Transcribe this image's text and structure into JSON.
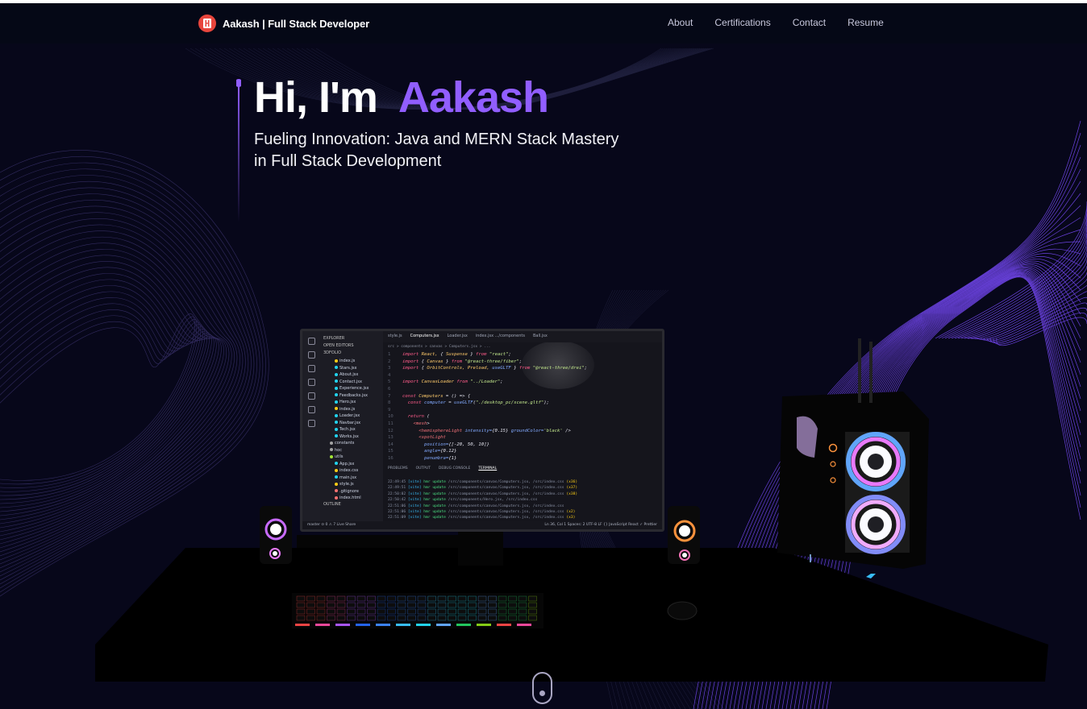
{
  "navbar": {
    "brand": "Aakash | Full Stack Developer",
    "links": [
      "About",
      "Certifications",
      "Contact",
      "Resume"
    ]
  },
  "hero": {
    "greeting": "Hi, I'm",
    "name": "Aakash",
    "subtitle": "Fueling Innovation: Java and MERN Stack Mastery in Full Stack Development"
  },
  "colors": {
    "background": "#07071a",
    "accent": "#915eff",
    "logo": "#e8453c"
  },
  "icons": {
    "logo": "logo-icon",
    "scroll": "scroll-down-icon"
  },
  "editor": {
    "explorer_title": "EXPLORER",
    "open_editors": "OPEN EDITORS",
    "project": "3DFOLIO",
    "files": [
      "index.js",
      "Stars.jsx",
      "About.jsx",
      "Contact.jsx",
      "Experience.jsx",
      "Feedbacks.jsx",
      "Hero.jsx",
      "index.js",
      "Loader.jsx",
      "Navbar.jsx",
      "Tech.jsx",
      "Works.jsx",
      "constants",
      "hoc",
      "utils",
      "App.jsx",
      "index.css",
      "main.jsx",
      "style.js",
      ".gitignore",
      "index.html"
    ],
    "outline": "OUTLINE",
    "tabs": [
      "style.js",
      "Computers.jsx",
      "Loader.jsx",
      "index.jsx .../components",
      "Ball.jsx"
    ],
    "breadcrumb": "src > components > canvas > Computers.jsx > ...",
    "code": [
      "import React, { Suspense } from \"react\";",
      "import { Canvas } from \"@react-three/fiber\";",
      "import { OrbitControls, Preload, useGLTF } from \"@react-three/drei\";",
      "",
      "import CanvasLoader from \"../Loader\";",
      "",
      "const Computers = () => {",
      "  const computer = useGLTF(\"./desktop_pc/scene.gltf\");",
      "",
      "  return (",
      "    <mesh>",
      "      <hemisphereLight intensity={0.15} groundColor='black' />",
      "      <spotLight",
      "        position={[-20, 50, 10]}",
      "        angle={0.12}",
      "        penumbra={1}"
    ],
    "panel_tabs": [
      "PROBLEMS",
      "OUTPUT",
      "DEBUG CONSOLE",
      "TERMINAL"
    ],
    "terminal": [
      "22:49:45 [vite] hmr update /src/components/canvas/Computers.jsx, /src/index.css (x36)",
      "22:49:51 [vite] hmr update /src/components/canvas/Computers.jsx, /src/index.css (x37)",
      "22:50:02 [vite] hmr update /src/components/canvas/Computers.jsx, /src/index.css (x38)",
      "22:50:42 [vite] hmr update /src/components/Hero.jsx, /src/index.css",
      "22:51:06 [vite] hmr update /src/components/canvas/Computers.jsx, /src/index.css",
      "22:51:06 [vite] hmr update /src/components/canvas/Computers.jsx, /src/index.css (x2)",
      "22:51:09 [vite] hmr update /src/components/canvas/Computers.jsx, /src/index.css (x3)"
    ],
    "status_left": "master  ⊙ 0 ⚠ 7  Live Share",
    "status_right": "Ln 36, Col 1  Spaces: 2  UTF-8  LF  {} JavaScript React  ✓ Prettier"
  }
}
